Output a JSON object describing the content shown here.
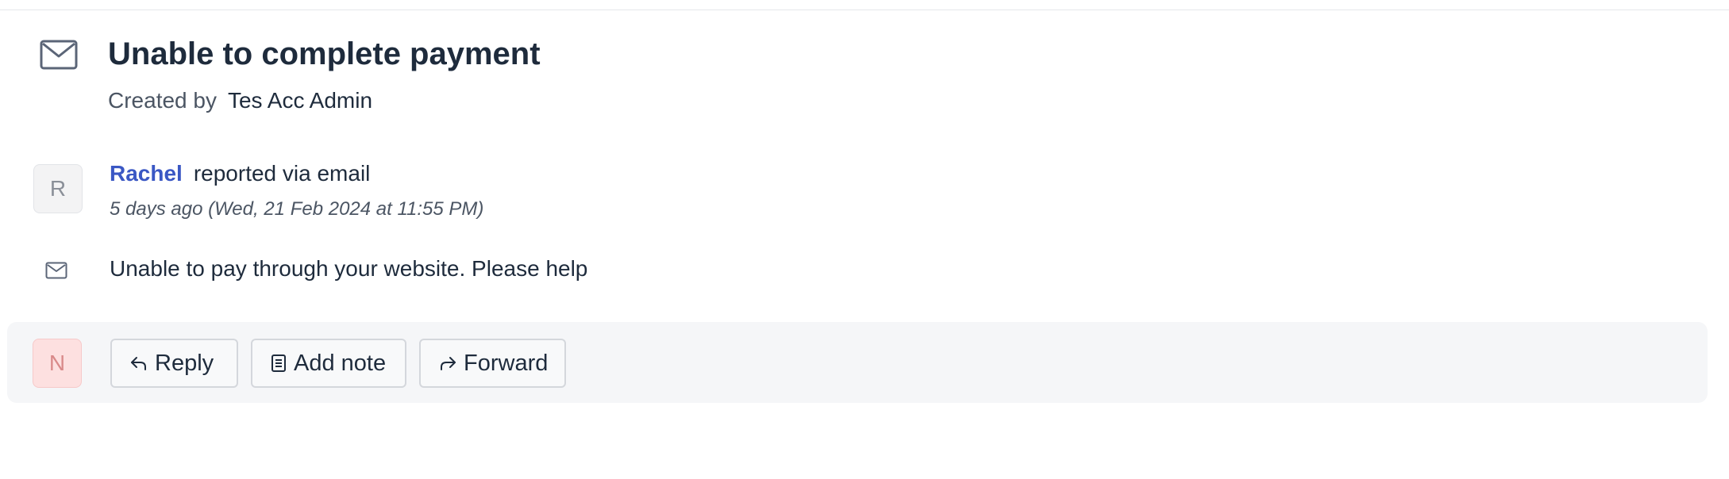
{
  "ticket": {
    "title": "Unable to complete payment",
    "created_prefix": "Created by",
    "created_by": "Tes Acc Admin",
    "icon": "mail-icon"
  },
  "message": {
    "avatar_initial": "R",
    "reporter": "Rachel",
    "action": "reported via email",
    "timestamp": "5 days ago (Wed, 21 Feb 2024 at 11:55 PM)",
    "channel_icon": "mail-icon",
    "body": "Unable to pay through your website. Please help"
  },
  "composer": {
    "avatar_initial": "N",
    "buttons": [
      {
        "label": "Reply",
        "icon": "reply-icon"
      },
      {
        "label": "Add note",
        "icon": "note-icon"
      },
      {
        "label": "Forward",
        "icon": "forward-icon"
      }
    ]
  },
  "colors": {
    "link": "#3a57c4",
    "text": "#1e2b3c",
    "muted": "#4b5563",
    "composer_bg": "#f5f6f8",
    "agent_avatar_bg": "#fde0e0"
  }
}
